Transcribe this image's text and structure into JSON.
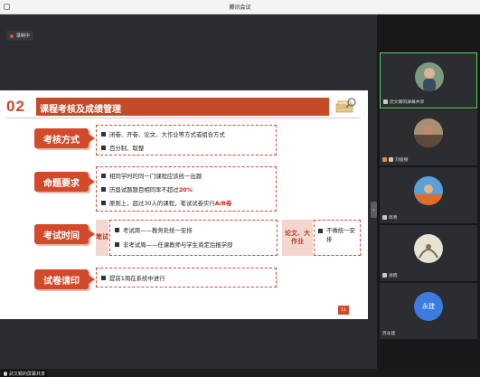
{
  "window": {
    "title": "腾讯会议"
  },
  "recording": {
    "label": "录制中"
  },
  "slide": {
    "number": "02",
    "title": "课程考核及成绩管理",
    "sections": [
      {
        "tag": "考核方式",
        "items": [
          "闭卷、开卷、论文、大作业等方式或组合方式",
          "百分制、取整"
        ]
      },
      {
        "tag": "命题要求",
        "items": [
          "相同学时的同一门课程应该统一出题",
          "历届试题题目相同率不超过",
          "原则上，超过30人的课程，笔试试卷实行"
        ],
        "highlights": [
          "20%",
          "A/B卷"
        ]
      },
      {
        "tag": "考试时间",
        "left_label": "笔试",
        "left_items": [
          "考试周——教务处统一安排",
          "非考试周——任课教师与学生商定后报学部"
        ],
        "right_label": "论文、大作业",
        "right_items": [
          "不做统一安排"
        ]
      },
      {
        "tag": "试卷请印",
        "items": [
          "提前1周在系统中进行"
        ]
      }
    ],
    "page": "11"
  },
  "share": {
    "label": "武文颖的屏幕共享"
  },
  "participants": [
    {
      "name": "武文颖的屏幕共享",
      "avatar": "photo-avatar-icon",
      "active": true
    },
    {
      "name": "刘俊楠",
      "avatar": "photo-avatar-icon",
      "active": false
    },
    {
      "name": "郎青",
      "avatar": "photo-avatar-icon",
      "active": false
    },
    {
      "name": "徐晓",
      "avatar": "photo-avatar-icon",
      "active": false
    },
    {
      "name": "苏永建",
      "avatar_text": "永建",
      "active": false
    }
  ],
  "colors": {
    "accent": "#d2492b",
    "highlight": "#d11f1f",
    "active_border": "#5fd06a"
  }
}
